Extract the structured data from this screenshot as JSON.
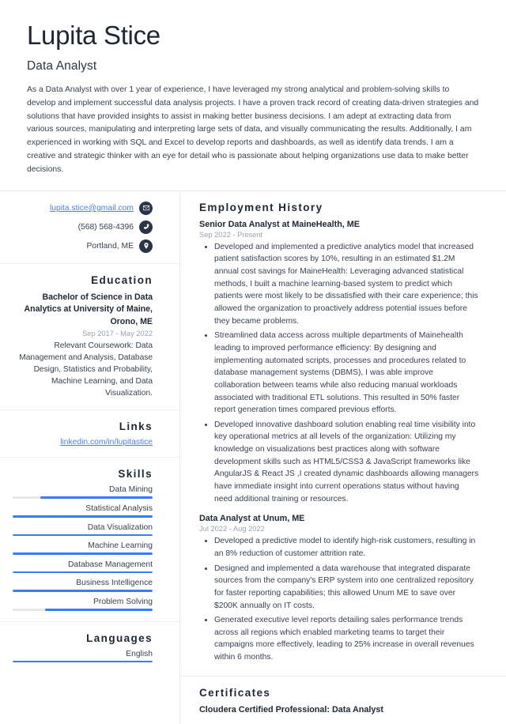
{
  "header": {
    "name": "Lupita Stice",
    "job_title": "Data Analyst",
    "summary": "As a Data Analyst with over 1 year of experience, I have leveraged my strong analytical and problem-solving skills to develop and implement successful data analysis projects. I have a proven track record of creating data-driven strategies and solutions that have provided insights to assist in making better business decisions. I am adept at extracting data from various sources, manipulating and interpreting large sets of data, and visually communicating the results. Additionally, I am experienced in working with SQL and Excel to develop reports and dashboards, as well as identify data trends. I am a creative and strategic thinker with an eye for detail who is passionate about helping organizations use data to make better decisions."
  },
  "colors": {
    "accent": "#3b7bf7",
    "link": "#4c7fe0",
    "text": "#39414f",
    "heading": "#1f2733",
    "muted": "#9aa1ad",
    "track": "#e7e8ea",
    "divider": "#e9eaee",
    "icon_bg": "#2b3445"
  },
  "sidebar": {
    "contact": {
      "items": [
        {
          "text": "lupita.stice@gmail.com",
          "icon": "envelope-icon",
          "is_link": true
        },
        {
          "text": "(568) 568-4396",
          "icon": "phone-icon",
          "is_link": false
        },
        {
          "text": "Portland, ME",
          "icon": "location-pin-icon",
          "is_link": false
        }
      ]
    },
    "education": {
      "heading": "Education",
      "degree": "Bachelor of Science in Data Analytics at University of Maine, Orono, ME",
      "date": "Sep 2017 - May 2022",
      "description": "Relevant Coursework: Data Management and Analysis, Database Design, Statistics and Probability, Machine Learning, and Data Visualization."
    },
    "links": {
      "heading": "Links",
      "items": [
        {
          "text": "linkedin.com/in/lupitastice"
        }
      ]
    },
    "skills": {
      "heading": "Skills",
      "items": [
        {
          "label": "Data Mining",
          "level": 80
        },
        {
          "label": "Statistical Analysis",
          "level": 100
        },
        {
          "label": "Data Visualization",
          "level": 100
        },
        {
          "label": "Machine Learning",
          "level": 100
        },
        {
          "label": "Database Management",
          "level": 100
        },
        {
          "label": "Business Intelligence",
          "level": 100
        },
        {
          "label": "Problem Solving",
          "level": 77
        }
      ]
    },
    "languages": {
      "heading": "Languages",
      "items": [
        {
          "label": "English",
          "level": 100
        }
      ]
    }
  },
  "main": {
    "employment": {
      "heading": "Employment History",
      "jobs": [
        {
          "role": "Senior Data Analyst at MaineHealth, ME",
          "date": "Sep 2022 - Present",
          "bullets": [
            "Developed and implemented a predictive analytics model that increased patient satisfaction scores by 10%, resulting in an estimated $1.2M annual cost savings for MaineHealth: Leveraging advanced statistical methods, I built a machine learning-based system to predict which patients were most likely to be dissatisfied with their care experience; this allowed the organization to proactively address potential issues before they became problems.",
            "Streamlined data access across multiple departments of Mainehealth leading to improved performance efficiency: By designing and implementing automated scripts, processes and procedures related to database management systems (DBMS), I was able improve collaboration between teams while also reducing manual workloads associated with traditional ETL solutions. This resulted in 50% faster report generation times compared previous efforts.",
            "Developed innovative dashboard solution enabling real time visibility into key operational metrics at all levels of the organization: Utilizing my knowledge on visualizations best practices along with software development skills such as HTML5/CSS3 & JavaScript frameworks like AngularJS & React JS ,I created dynamic dashboards allowing managers have immediate insight into current operations status without having need additional training or resources."
          ]
        },
        {
          "role": "Data Analyst at Unum, ME",
          "date": "Jul 2022 - Aug 2022",
          "bullets": [
            "Developed a predictive model to identify high-risk customers, resulting in an 8% reduction of customer attrition rate.",
            "Designed and implemented a data warehouse that integrated disparate sources from the company's ERP system into one centralized repository for faster reporting capabilities; this allowed Unum ME to save over $200K annually on IT costs.",
            "Generated executive level reports detailing sales performance trends across all regions which enabled marketing teams to target their campaigns more effectively, leading to 25% increase in overall revenues within 6 months."
          ]
        }
      ]
    },
    "certificates": {
      "heading": "Certificates",
      "items": [
        {
          "name": "Cloudera Certified Professional: Data Analyst"
        }
      ]
    }
  }
}
